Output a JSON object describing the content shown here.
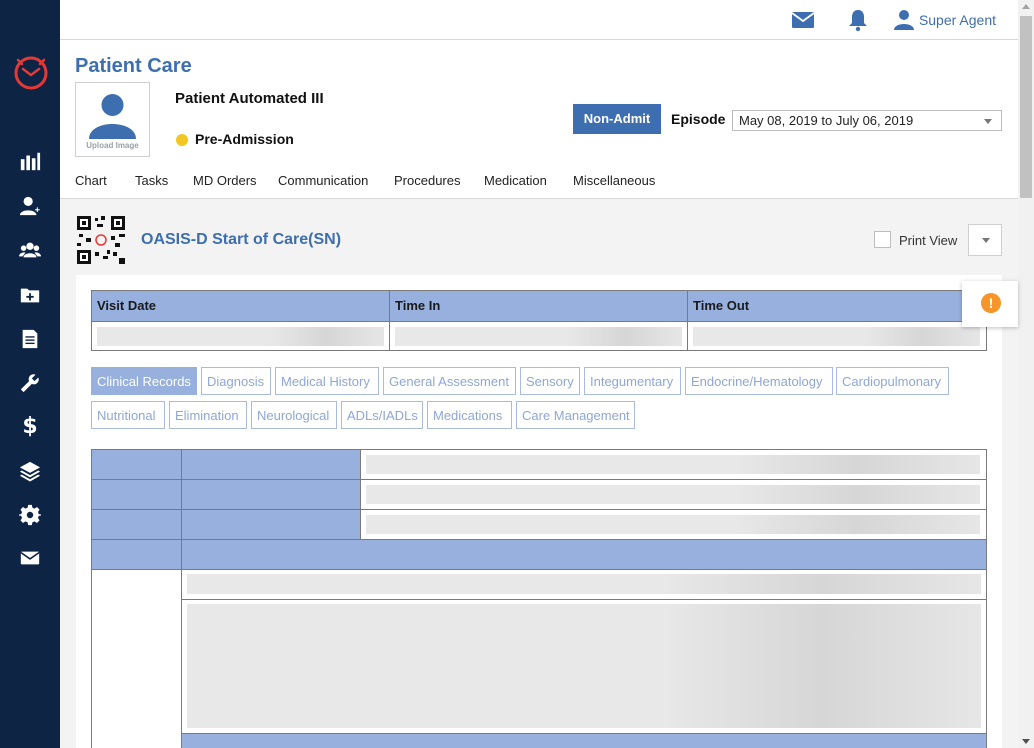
{
  "app": {
    "brand_color": "#3d6fb0",
    "sidebar_color": "#0e2445"
  },
  "header": {
    "user_name": "Super Agent",
    "icons": [
      "mail-icon",
      "bell-icon",
      "user-icon"
    ]
  },
  "sidebar": {
    "items": [
      "chart-bar-icon",
      "add-user-icon",
      "users-icon",
      "folder-add-icon",
      "document-icon",
      "wrench-icon",
      "dollar-icon",
      "layers-icon",
      "gear-icon",
      "mail-icon"
    ],
    "dollar_glyph": "$"
  },
  "page": {
    "title": "Patient Care",
    "upload_label": "Upload Image",
    "patient_name": "Patient Automated III",
    "status": "Pre-Admission",
    "status_color": "#f3c623",
    "non_admit_label": "Non-Admit",
    "episode_label": "Episode",
    "episode_value": "May 08, 2019 to July 06, 2019"
  },
  "tabs": [
    "Chart",
    "Tasks",
    "MD Orders",
    "Communication",
    "Procedures",
    "Medication",
    "Miscellaneous"
  ],
  "form": {
    "title": "OASIS-D Start of Care(SN)",
    "print_view_label": "Print View",
    "alert_glyph": "!",
    "visit_headers": [
      "Visit Date",
      "Time In",
      "Time Out"
    ],
    "section_tabs_row1": [
      "Clinical Records",
      "Diagnosis",
      "Medical History",
      "General Assessment",
      "Sensory",
      "Integumentary",
      "Endocrine/Hematology",
      "Cardiopulmonary"
    ],
    "section_tabs_row2": [
      "Nutritional",
      "Elimination",
      "Neurological",
      "ADLs/IADLs",
      "Medications",
      "Care Management"
    ],
    "active_section": "Clinical Records"
  }
}
